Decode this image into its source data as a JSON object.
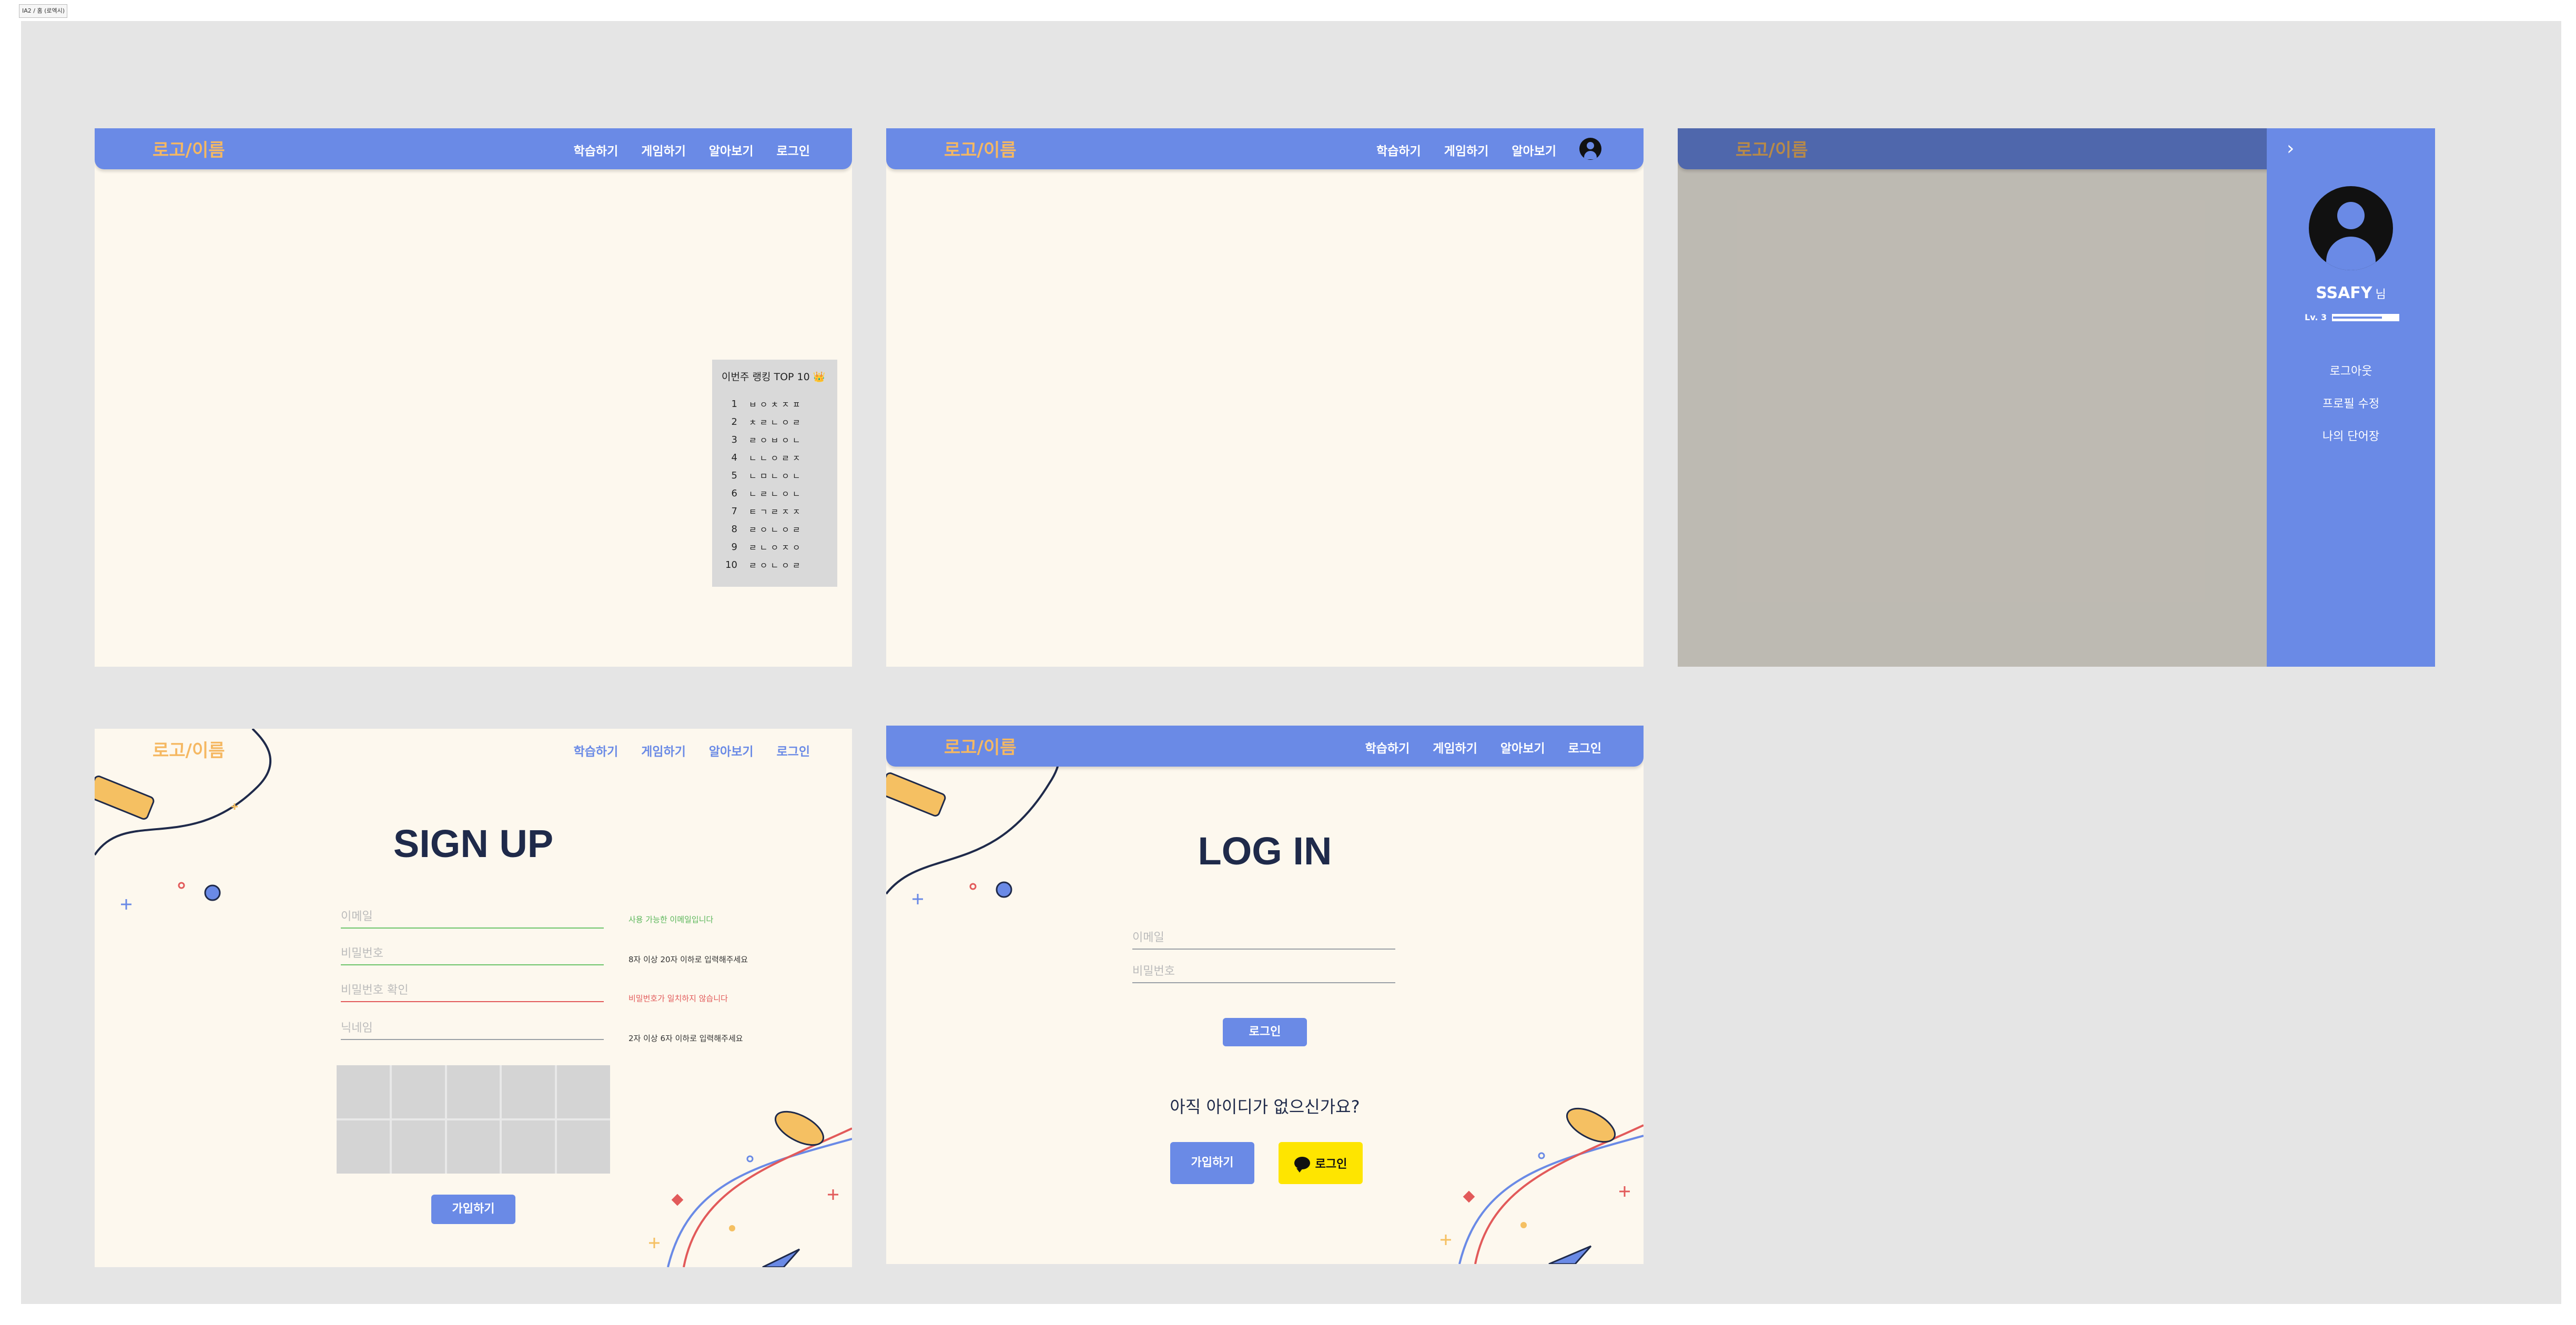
{
  "frame_label": "IA2 / 홈 (로엑시)",
  "nav": {
    "logo": "로고/이름",
    "learn": "학습하기",
    "game": "게임하기",
    "explore": "알아보기",
    "login": "로그인"
  },
  "ranking": {
    "title": "이번주 랭킹 TOP 10 👑",
    "items": [
      {
        "rank": "1",
        "name": "ㅂㅇㅊㅈㅍ"
      },
      {
        "rank": "2",
        "name": "ㅊㄹㄴㅇㄹ"
      },
      {
        "rank": "3",
        "name": "ㄹㅇㅂㅇㄴ"
      },
      {
        "rank": "4",
        "name": "ㄴㄴㅇㄹㅈ"
      },
      {
        "rank": "5",
        "name": "ㄴㅁㄴㅇㄴ"
      },
      {
        "rank": "6",
        "name": "ㄴㄹㄴㅇㄴ"
      },
      {
        "rank": "7",
        "name": "ㅌㄱㄹㅈㅈ"
      },
      {
        "rank": "8",
        "name": "ㄹㅇㄴㅇㄹ"
      },
      {
        "rank": "9",
        "name": "ㄹㄴㅇㅈㅇ"
      },
      {
        "rank": "10",
        "name": "ㄹㅇㄴㅇㄹ"
      }
    ]
  },
  "sidebar": {
    "username": "SSAFY",
    "suffix": "님",
    "level": "Lv. 3",
    "level_progress": 0.75,
    "menu": [
      "로그아웃",
      "프로필 수정",
      "나의 단어장"
    ]
  },
  "signup": {
    "title": "SIGN UP",
    "email_placeholder": "이메일",
    "password_placeholder": "비밀번호",
    "password_confirm_placeholder": "비밀번호 확인",
    "nickname_placeholder": "닉네임",
    "email_hint": "사용 가능한 이메일입니다",
    "password_hint": "8자 이상 20자 이하로 입력해주세요",
    "confirm_hint": "비밀번호가 일치하지 않습니다",
    "nickname_hint": "2자 이상 6자 이하로 입력해주세요",
    "submit": "가입하기"
  },
  "login": {
    "title": "LOG IN",
    "email_placeholder": "이메일",
    "password_placeholder": "비밀번호",
    "submit": "로그인",
    "question": "아직 아이디가 없으신가요?",
    "signup_button": "가입하기",
    "kakao_button": "로그인"
  },
  "colors": {
    "primary": "#6a8ae6",
    "background": "#fdf8ee",
    "logo": "#f5b862",
    "heading": "#1f2a4a",
    "kakao": "#fee500",
    "ok": "#5bb75b",
    "error": "#e25a5a"
  }
}
